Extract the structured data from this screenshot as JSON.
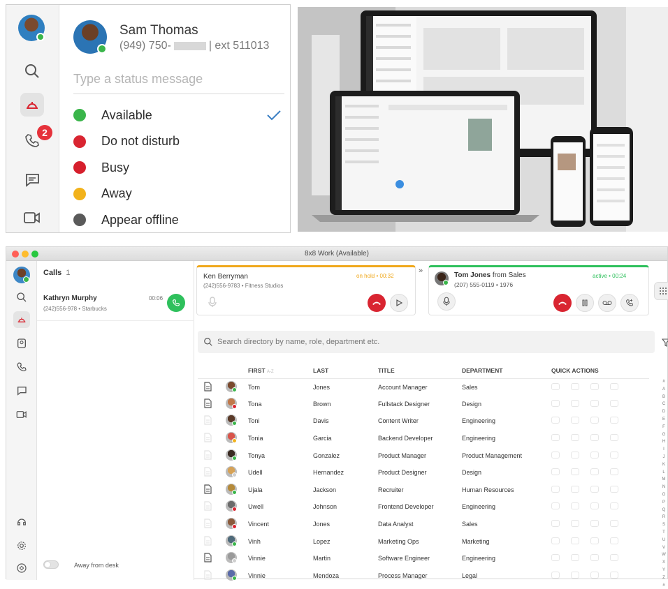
{
  "status_panel": {
    "rail_badge": "2",
    "user_name": "Sam Thomas",
    "phone_prefix": "(949) 750-",
    "phone_ext": "| ext 511013",
    "status_placeholder": "Type a status message",
    "statuses": [
      {
        "label": "Available",
        "color": "#3ab54a",
        "selected": true
      },
      {
        "label": "Do not disturb",
        "color": "#d92531"
      },
      {
        "label": "Busy",
        "color": "#d61f2c"
      },
      {
        "label": "Away",
        "color": "#f2b21b"
      },
      {
        "label": "Appear offline",
        "color": "#5a5a5a"
      }
    ]
  },
  "app": {
    "window_title": "8x8 Work (Available)",
    "calls_header": "Calls",
    "calls_count": "1",
    "call_item": {
      "name": "Kathryn Murphy",
      "sub": "(242)556-978 • Starbucks",
      "time": "00:06"
    },
    "away_toggle_label": "Away from desk",
    "hold_call": {
      "name": "Ken Berryman",
      "sub": "(242)556-9783 • Fitness Studios",
      "status": "on hold • 00:32"
    },
    "active_call": {
      "name": "Tom Jones",
      "from": "from Sales",
      "sub": "(207) 555-0119 • 1976",
      "status": "active • 00:24"
    },
    "search_placeholder": "Search directory by name, role, department etc.",
    "columns": {
      "first": "FIRST",
      "first_sort": "A-Z",
      "last": "LAST",
      "title": "TITLE",
      "department": "DEPARTMENT",
      "quick_actions": "QUICK ACTIONS"
    },
    "rows": [
      {
        "first": "Tom",
        "last": "Jones",
        "title": "Account Manager",
        "department": "Sales",
        "note": true,
        "presence": "#3ab54a"
      },
      {
        "first": "Tona",
        "last": "Brown",
        "title": "Fullstack Designer",
        "department": "Design",
        "note": true,
        "presence": "#d92531"
      },
      {
        "first": "Toni",
        "last": "Davis",
        "title": "Content Writer",
        "department": "Engineering",
        "note": false,
        "presence": "#3ab54a"
      },
      {
        "first": "Tonia",
        "last": "Garcia",
        "title": "Backend Developer",
        "department": "Engineering",
        "note": false,
        "presence": "#f2b21b"
      },
      {
        "first": "Tonya",
        "last": "Gonzalez",
        "title": "Product Manager",
        "department": "Product Management",
        "note": false,
        "presence": "#3ab54a"
      },
      {
        "first": "Udell",
        "last": "Hernandez",
        "title": "Product Designer",
        "department": "Design",
        "note": false,
        "presence": "#cfcfcf"
      },
      {
        "first": "Ujala",
        "last": "Jackson",
        "title": "Recruiter",
        "department": "Human Resources",
        "note": true,
        "presence": "#3ab54a"
      },
      {
        "first": "Uwell",
        "last": "Johnson",
        "title": "Frontend Developer",
        "department": "Engineering",
        "note": false,
        "presence": "#d92531"
      },
      {
        "first": "Vincent",
        "last": "Jones",
        "title": "Data Analyst",
        "department": "Sales",
        "note": false,
        "presence": "#d92531"
      },
      {
        "first": "Vinh",
        "last": "Lopez",
        "title": "Marketing Ops",
        "department": "Marketing",
        "note": false,
        "presence": "#3ab54a"
      },
      {
        "first": "Vinnie",
        "last": "Martin",
        "title": "Software Engineer",
        "department": "Engineering",
        "note": true,
        "presence": "#cfcfcf"
      },
      {
        "first": "Vinnie",
        "last": "Mendoza",
        "title": "Process Manager",
        "department": "Legal",
        "note": false,
        "presence": "#3ab54a"
      }
    ],
    "alphabet": [
      "#",
      "A",
      "B",
      "C",
      "D",
      "E",
      "F",
      "G",
      "H",
      "I",
      "J",
      "K",
      "L",
      "M",
      "N",
      "O",
      "P",
      "Q",
      "R",
      "S",
      "T",
      "U",
      "V",
      "W",
      "X",
      "Y",
      "Z",
      "#"
    ]
  },
  "colors": {
    "accent_green": "#2ec05c",
    "hangup_red": "#d92531",
    "hold_orange": "#f0a81c"
  }
}
